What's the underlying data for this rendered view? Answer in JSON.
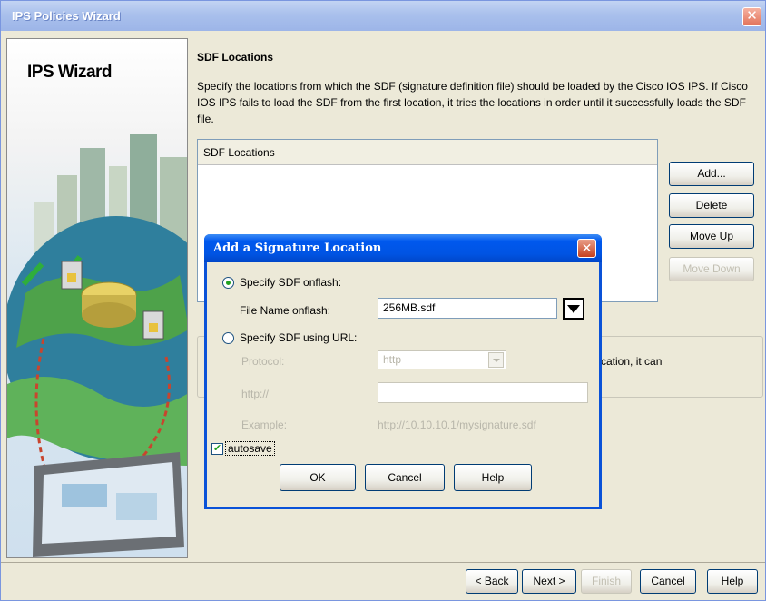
{
  "window": {
    "title": "IPS Policies Wizard",
    "close_glyph": "✕"
  },
  "sidebar": {
    "title": "IPS Wizard"
  },
  "page": {
    "section_title": "SDF Locations",
    "description": "Specify the locations from which the SDF (signature definition file) should be loaded by the Cisco IOS IPS. If Cisco IOS IPS fails to load the SDF from the first location, it tries the locations in order until it successfully loads the SDF file.",
    "list_header": "SDF Locations",
    "buttons": {
      "add": "Add...",
      "delete": "Delete",
      "move_up": "Move Up",
      "move_down": "Move Down"
    },
    "group_partial_text": "cation, it can"
  },
  "nav": {
    "back": "< Back",
    "next": "Next >",
    "finish": "Finish",
    "cancel": "Cancel",
    "help": "Help"
  },
  "dialog": {
    "title": "Add a Signature Location",
    "close_glyph": "✕",
    "option_onflash": {
      "label": "Specify SDF onflash:",
      "checked": true
    },
    "file_name_label": "File Name onflash:",
    "file_name_value": "256MB.sdf",
    "option_url": {
      "label": "Specify SDF using URL:",
      "checked": false
    },
    "protocol_label": "Protocol:",
    "protocol_value": "http",
    "url_label": "http://",
    "url_value": "",
    "example_label": "Example:",
    "example_value": "http://10.10.10.1/mysignature.sdf",
    "autosave_label": "autosave",
    "autosave_checked": true,
    "buttons": {
      "ok": "OK",
      "cancel": "Cancel",
      "help": "Help"
    }
  },
  "colors": {
    "dialog_title": "#0054e3",
    "window_title": "#a9c0ec",
    "panel": "#ece9d8"
  }
}
